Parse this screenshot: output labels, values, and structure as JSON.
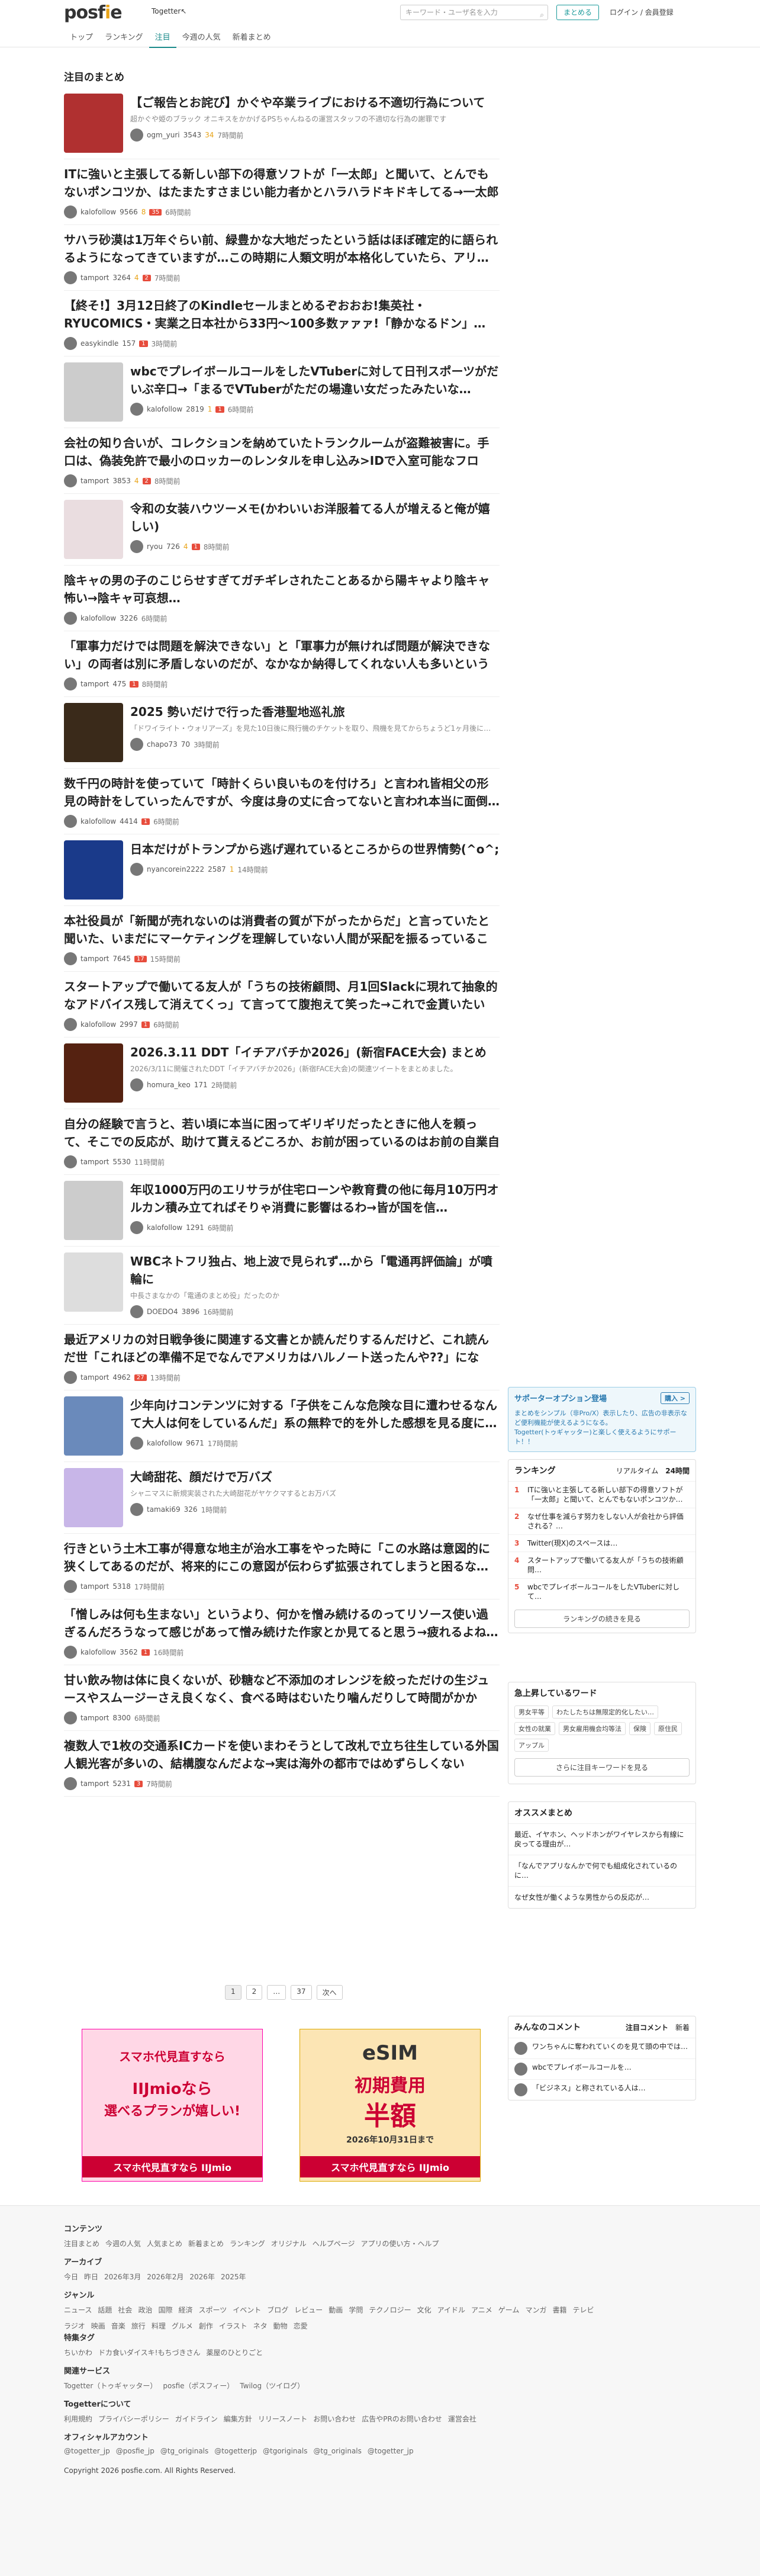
{
  "header": {
    "logo_a": "posf",
    "logo_b": "i",
    "logo_c": "e",
    "togetter": "Togetter↖",
    "search_placeholder": "キーワード・ユーザ名を入力",
    "matome_button": "まとめる",
    "login": "ログイン / 会員登録"
  },
  "nav": [
    "トップ",
    "ランキング",
    "注目",
    "今週の人気",
    "新着まとめ"
  ],
  "section_title": "注目のまとめ",
  "items": [
    {
      "title": "【ご報告とお詫び】かぐや卒業ライブにおける不適切行為について",
      "desc": "超かぐや姫のブラック オニキスをかかげるPSちゃんねるの運営スタッフの不適切な行為の謝罪です",
      "user": "ogm_yuri",
      "count": "3543",
      "favs": "34",
      "ago": "7時間前",
      "thumb": true,
      "color": "#b03030"
    },
    {
      "title": "ITに強いと主張してる新しい部下の得意ソフトが「一太郎」と聞いて、とんでもないポンコツか、はたまたすさまじい能力者かとハラハラドキドキしてる→一太郎か…",
      "user": "kalofollow",
      "count": "9566",
      "favs": "8",
      "new": "35",
      "ago": "6時間前"
    },
    {
      "title": "サハラ砂漠は1万年ぐらい前、緑豊かな大地だったという話はほぼ確定的に語られるようになってきていますが…この時期に人類文明が本格化していたら、アリ…",
      "user": "tamport",
      "count": "3264",
      "favs": "4",
      "new": "2",
      "ago": "7時間前"
    },
    {
      "title": "【終そ!】3月12日終了のKindleセールまとめるぞおおお!集英社・RYUCOMICS・実業之日本社から33円〜100多数ァァァ!「静かなるドン」…",
      "user": "easykindle",
      "count": "157",
      "favs": "",
      "new": "1",
      "ago": "3時間前"
    },
    {
      "title": "wbcでプレイボールコールをしたVTuberに対して日刊スポーツがだいぶ辛口→「まるでVTuberがただの場違い女だったみたいな…",
      "user": "kalofollow",
      "count": "2819",
      "favs": "1",
      "new": "1",
      "ago": "6時間前",
      "thumb": true,
      "color": "#cccccc"
    },
    {
      "title": "会社の知り合いが、コレクションを納めていたトランクルームが盗難被害に。手口は、偽装免許で最小のロッカーのレンタルを申し込み>IDで入室可能なフロア…",
      "user": "tamport",
      "count": "3853",
      "favs": "4",
      "new": "2",
      "ago": "8時間前"
    },
    {
      "title": "令和の女装ハウツーメモ(かわいいお洋服着てる人が増えると俺が嬉しい)",
      "user": "ryou",
      "count": "726",
      "favs": "4",
      "new": "1",
      "ago": "8時間前",
      "thumb": true,
      "color": "#eadde0"
    },
    {
      "title": "陰キャの男の子のこじらせすぎてガチギレされたことあるから陽キャより陰キャ怖い→陰キャ可哀想…",
      "user": "kalofollow",
      "count": "3226",
      "favs": "",
      "new": "",
      "ago": "6時間前"
    },
    {
      "title": "「軍事力だけでは問題を解決できない」と「軍事力が無ければ問題が解決できない」の両者は別に矛盾しないのだが、なかなか納得してくれない人も多いという話",
      "user": "tamport",
      "count": "475",
      "favs": "",
      "new": "1",
      "ago": "8時間前"
    },
    {
      "title": "2025 勢いだけで行った香港聖地巡礼旅",
      "desc": "「ドワイライト・ウォリアーズ」を見た10日後に飛行機のチケットを取り、飛機を見てからちょうど1ヶ月後に…",
      "user": "chapo73",
      "count": "70",
      "favs": "",
      "new": "",
      "ago": "3時間前",
      "thumb": true,
      "color": "#3a2a1a"
    },
    {
      "title": "数千円の時計を使っていて「時計くらい良いものを付けろ」と言われ皆相父の形見の時計をしていったんですが、今度は身の丈に合ってないと言われ本当に面倒…",
      "user": "kalofollow",
      "count": "4414",
      "favs": "",
      "new": "1",
      "ago": "6時間前"
    },
    {
      "title": "日本だけがトランプから逃げ遅れているところからの世界情勢(^o^;",
      "user": "nyancorein2222",
      "count": "2587",
      "favs": "1",
      "new": "",
      "ago": "14時間前",
      "thumb": true,
      "color": "#1a3a8a"
    },
    {
      "title": "本社役員が「新聞が売れないのは消費者の質が下がったからだ」と言っていたと聞いた、いまだにマーケティングを理解していない人間が采配を振るっていること…",
      "user": "tamport",
      "count": "7645",
      "favs": "",
      "new": "17",
      "ago": "15時間前"
    },
    {
      "title": "スタートアップで働いてる友人が「うちの技術顧問、月1回Slackに現れて抽象的なアドバイス残して消えてくっ」て言ってて腹抱えて笑った→これで金貰いたい",
      "user": "kalofollow",
      "count": "2997",
      "favs": "",
      "new": "1",
      "ago": "6時間前"
    },
    {
      "title": "2026.3.11 DDT「イチアバチか2026」(新宿FACE大会) まとめ",
      "desc": "2026/3/11に開催されたDDT「イチアバチか2026」(新宿FACE大会)の関連ツイートをまとめました。",
      "user": "homura_keo",
      "count": "171",
      "favs": "",
      "new": "",
      "ago": "2時間前",
      "thumb": true,
      "color": "#552211"
    },
    {
      "title": "自分の経験で言うと、若い頃に本当に困ってギリギリだったときに他人を頼って、そこでの反応が、助けて貰えるどころか、お前が困っているのはお前の自業自得で、…",
      "user": "tamport",
      "count": "5530",
      "favs": "",
      "new": "",
      "ago": "11時間前"
    },
    {
      "title": "年収1000万円のエリサラが住宅ローンや教育費の他に毎月10万円オルカン積み立てればそりゃ消費に影響はるわ→皆が国を信…",
      "user": "kalofollow",
      "count": "1291",
      "favs": "",
      "new": "",
      "ago": "6時間前",
      "thumb": true,
      "color": "#cccccc"
    },
    {
      "title": "WBCネトフリ独占、地上波で見られず…から「電通再評価論」が噴輪に",
      "desc": "中長さまなかの「電通のまとめ役」だったのか",
      "user": "DOEDO4",
      "count": "3896",
      "favs": "",
      "new": "",
      "ago": "16時間前",
      "thumb": true,
      "color": "#dddddd"
    },
    {
      "title": "最近アメリカの対日戦争後に関連する文書とか読んだりするんだけど、これ読んだ世「これほどの準備不足でなんでアメリカはハルノート送ったんや??」になる…",
      "user": "tamport",
      "count": "4962",
      "favs": "",
      "new": "27",
      "ago": "13時間前"
    },
    {
      "title": "少年向けコンテンツに対する「子供をこんな危険な目に遭わせるなんて大人は何をしているんだ」系の無粋で的を外した感想を見る度に…",
      "user": "kalofollow",
      "count": "9671",
      "favs": "",
      "new": "",
      "ago": "17時間前",
      "thumb": true,
      "color": "#6a8abb"
    },
    {
      "title": "大崎甜花、顔だけで万バズ",
      "desc": "シャニマスに新規実装された大崎甜花がヤケクマするとお万バズ",
      "user": "tamaki69",
      "count": "326",
      "favs": "",
      "new": "",
      "ago": "1時間前",
      "thumb": true,
      "color": "#c8b6e8"
    },
    {
      "title": "行きという土木工事が得意な地主が治水工事をやった時に「この水路は意図的に狭くしてあるのだが、将来的にこの意図が伝わらず拡張されてしまうと困るな…",
      "user": "tamport",
      "count": "5318",
      "favs": "",
      "new": "",
      "ago": "17時間前"
    },
    {
      "title": "「憎しみは何も生まない」というより、何かを憎み続けるのってリソース使い過ぎるんだろうなって感じがあって憎み続けた作家とか見てると思う→疲れるよね…",
      "user": "kalofollow",
      "count": "3562",
      "favs": "",
      "new": "1",
      "ago": "16時間前"
    },
    {
      "title": "甘い飲み物は体に良くないが、砂糖など不添加のオレンジを絞っただけの生ジュースやスムージーさえ良くなく、食べる時はむいたり噛んだりして時間がかかる…",
      "user": "tamport",
      "count": "8300",
      "favs": "",
      "new": "",
      "ago": "6時間前"
    },
    {
      "title": "複数人で1枚の交通系ICカードを使いまわそうとして改札で立ち往生している外国人観光客が多いの、結構腹なんだよな→実は海外の都市ではめずらしくない",
      "user": "tamport",
      "count": "5231",
      "favs": "",
      "new": "3",
      "ago": "7時間前"
    }
  ],
  "pager": [
    "1",
    "2",
    "…",
    "37",
    "次へ"
  ],
  "ads": {
    "ad1_line1": "スマホ代見直すなら",
    "ad1_line2": "IIJmioなら",
    "ad1_line3": "選べるプランが嬉しい!",
    "ad1_line4": "スマホ代見直すなら IIJmio",
    "ad2_line1": "eSIM",
    "ad2_line2": "初期費用",
    "ad2_line3": "半額",
    "ad2_line4": "2026年10月31日まで",
    "ad2_line5": "スマホ代見直すなら IIJmio"
  },
  "sidebar": {
    "supporter_title": "サポーターオプション登場",
    "supporter_button": "購入 >",
    "supporter_text": "まとめをシンプル（非Pro/X）表示したり、広告の非表示など便利機能が使えるようになる。\nTogetter(トゥギャッター)と楽しく使えるようにサポート！！",
    "ranking_title": "ランキング",
    "ranking_tab1": "リアルタイム",
    "ranking_tab2": "24時間",
    "ranking": [
      "ITに強いと主張してる新しい部下の得意ソフトが「一太郎」と聞いて、とんでもないポンコツか…",
      "なぜ仕事を減らす努力をしない人が会社から評価される？…",
      "Twitter(現X)のスペースは…",
      "スタートアップで働いてる友人が「うちの技術顧問…",
      "wbcでプレイボールコールをしたVTuberに対して…"
    ],
    "ranking_more": "ランキングの続きを見る",
    "keywords_title": "急上昇しているワード",
    "keywords": [
      "男女平等",
      "わたしたちは無限定的化したい…",
      "女性の就業",
      "男女雇用機会均等法",
      "保険",
      "原住民",
      "アップル"
    ],
    "keywords_more": "さらに注目キーワードを見る",
    "recommend_title": "オススメまとめ",
    "recommend": [
      "最近、イヤホン、ヘッドホンがワイヤレスから有線に戻ってる理由が…",
      "「なんでアプリなんかで何でも組成化されているのに…",
      "なぜ女性が働くような男性からの反応が…"
    ],
    "comments_title": "みんなのコメント",
    "comments_tab1": "注目コメント",
    "comments_tab2": "新着",
    "comments": [
      "ワンちゃんに奪われていくのを見て頭の中では…",
      "wbcでプレイボールコールを…",
      "「ビジネス」と称されている人は…"
    ]
  },
  "footer": {
    "contents_h": "コンテンツ",
    "contents": [
      "注目まとめ",
      "今週の人気",
      "人気まとめ",
      "新着まとめ",
      "ランキング",
      "オリジナル",
      "ヘルプページ",
      "アプリの使い方・ヘルプ"
    ],
    "archive_h": "アーカイブ",
    "archive": [
      "今日",
      "昨日",
      "2026年3月",
      "2026年2月",
      "2026年",
      "2025年"
    ],
    "genre_h": "ジャンル",
    "genre": [
      "ニュース",
      "話題",
      "社会",
      "政治",
      "国際",
      "経済",
      "スポーツ",
      "イベント",
      "ブログ",
      "レビュー",
      "動画",
      "学問",
      "テクノロジー",
      "文化",
      "アイドル",
      "アニメ",
      "ゲーム",
      "マンガ",
      "書籍",
      "テレビ",
      "ラジオ",
      "映画",
      "音楽",
      "旅行",
      "料理",
      "グルメ",
      "創作",
      "イラスト",
      "ネタ",
      "動物",
      "恋愛"
    ],
    "special_h": "特集タグ",
    "special": [
      "ちいかわ",
      "ドカ食いダイスキ!もちづきさん",
      "薬屋のひとりごと"
    ],
    "related_h": "関連サービス",
    "related": [
      "Togetter（トゥギャッター）",
      "posfie（ポスフィー）",
      "Twilog（ツイログ）"
    ],
    "about_h": "Togetterについて",
    "about": [
      "利用規約",
      "プライバシーポリシー",
      "ガイドライン",
      "編集方針",
      "リリースノート",
      "お問い合わせ",
      "広告やPRのお問い合わせ",
      "運営会社"
    ],
    "sns_h": "オフィシャルアカウント",
    "sns": [
      "@togetter_jp",
      "@posfie_jp",
      "@tg_originals",
      "@togetterjp",
      "@tgoriginals",
      "@tg_originals",
      "@togetter_jp"
    ],
    "copyright": "Copyright 2026 posfie.com. All Rights Reserved."
  }
}
